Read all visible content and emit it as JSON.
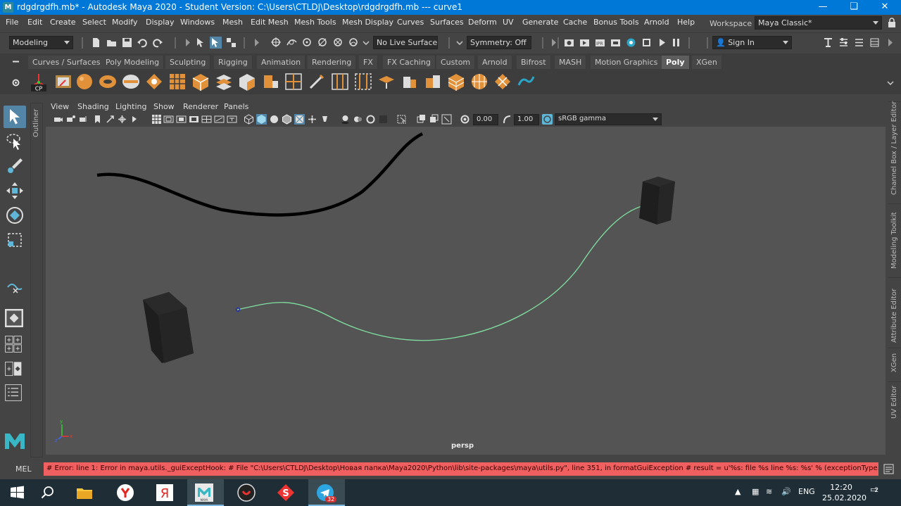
{
  "window": {
    "title": "rdgdrgdfh.mb* - Autodesk Maya 2020 - Student Version: C:\\Users\\CTLDJ\\Desktop\\rdgdrgdfh.mb   ---   curve1",
    "app_icon": "M",
    "minimize_icon": "minimize-icon",
    "maximize_icon": "maximize-icon",
    "close_icon": "close-icon"
  },
  "menubar": {
    "items": [
      "File",
      "Edit",
      "Create",
      "Select",
      "Modify",
      "Display",
      "Windows",
      "Mesh",
      "Edit Mesh",
      "Mesh Tools",
      "Mesh Display",
      "Curves",
      "Surfaces",
      "Deform",
      "UV",
      "Generate",
      "Cache",
      "Bonus Tools",
      "Arnold",
      "Help"
    ],
    "workspace_label": "Workspace :",
    "workspace_value": "Maya Classic*"
  },
  "statusline": {
    "mode": "Modeling",
    "live_surface": "No Live Surface",
    "symmetry": "Symmetry: Off",
    "sign_in": "Sign In"
  },
  "shelf": {
    "tabs": [
      "Curves / Surfaces",
      "Poly Modeling",
      "Sculpting",
      "Rigging",
      "Animation",
      "Rendering",
      "FX",
      "FX Caching",
      "Custom",
      "Arnold",
      "Bifrost",
      "MASH",
      "Motion Graphics",
      "Poly",
      "XGen"
    ],
    "active_tab": "Poly",
    "cp_label": "CP"
  },
  "outliner": {
    "label": "Outliner"
  },
  "panel": {
    "menu": [
      "View",
      "Shading",
      "Lighting",
      "Show",
      "Renderer",
      "Panels"
    ],
    "exposure": "0.00",
    "gamma": "1.00",
    "color_space": "sRGB gamma",
    "camera": "persp"
  },
  "right_tabs": [
    "Channel Box / Layer Editor",
    "Modeling Toolkit",
    "Attribute Editor",
    "XGen",
    "UV Editor"
  ],
  "cmdline": {
    "language": "MEL",
    "error": "# Error: line 1: Error in  maya.utils._guiExceptHook: #    File \"C:\\Users\\CTLDJ\\Desktop\\Новая папка\\Maya2020\\Python\\lib\\site-packages\\maya\\utils.py\", line 351, in formatGuiException #     result = u'%s: file %s line %s: %s' % (exceptionType.__name__"
  },
  "taskbar": {
    "apps": [
      "windows-start-icon",
      "search-icon",
      "file-explorer-icon",
      "yandex-browser-icon",
      "yandex-icon",
      "maya-icon",
      "app-icon",
      "app-s-icon",
      "telegram-icon"
    ],
    "maya_label": "MAYA",
    "telegram_badge": "32",
    "language": "ENG",
    "time": "12:20",
    "date": "25.02.2020",
    "notifications_count": "2"
  },
  "colors": {
    "accent": "#0078d7",
    "viewport_bg": "#545454",
    "selected_curve": "#7fe0a0",
    "error_bg": "#f06060",
    "active_tool": "#5285a6"
  }
}
